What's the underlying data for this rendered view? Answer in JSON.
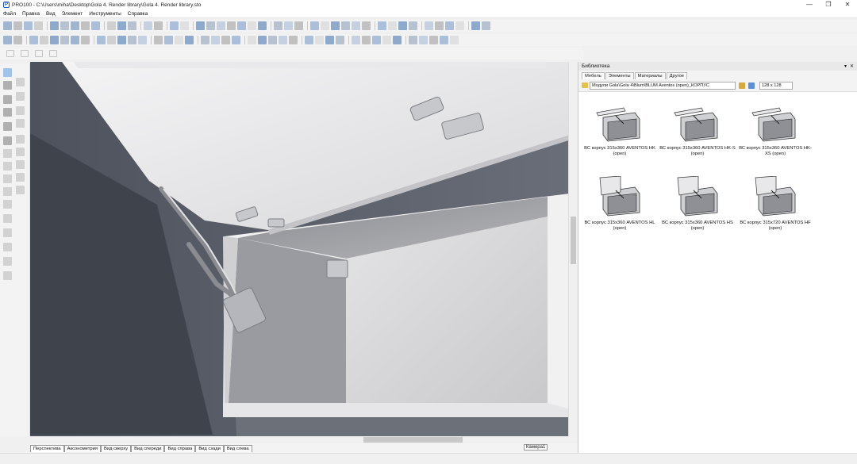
{
  "window": {
    "title": "PRO100 - C:\\Users\\miha\\Desktop\\Gola 4. Render library\\Gola 4. Render library.sto",
    "min": "—",
    "max": "❐",
    "close": "✕"
  },
  "menu": [
    "Файл",
    "Правка",
    "Вид",
    "Элемент",
    "Инструменты",
    "Справка"
  ],
  "view_tabs": [
    "Перспектива",
    "Аксонометрия",
    "Вид сверху",
    "Вид спереди",
    "Вид справа",
    "Вид сзади",
    "Вид слева"
  ],
  "camera_label": "Камера1",
  "library": {
    "title": "Библиотека",
    "tabs": [
      "Мебель",
      "Элементы",
      "Материалы",
      "Другое"
    ],
    "path": "Модули Gola\\Gola 4\\Blum\\BLUM Aventos (open)_КОРПУС",
    "thumb_size": "128 x 128",
    "items": [
      {
        "caption": "ВС корпус 315х360 AVENTOS HK (open)"
      },
      {
        "caption": "ВС корпус 315х360 AVENTOS HK-S (open)"
      },
      {
        "caption": "ВС корпус 315х360 AVENTOS HK-XS (open)"
      },
      {
        "caption": "ВС корпус 315х360 AVENTOS HL (open)"
      },
      {
        "caption": "ВС корпус 315х360 AVENTOS HS (open)"
      },
      {
        "caption": "ВС корпус 315х720 AVENTOS HF (open)"
      }
    ]
  }
}
